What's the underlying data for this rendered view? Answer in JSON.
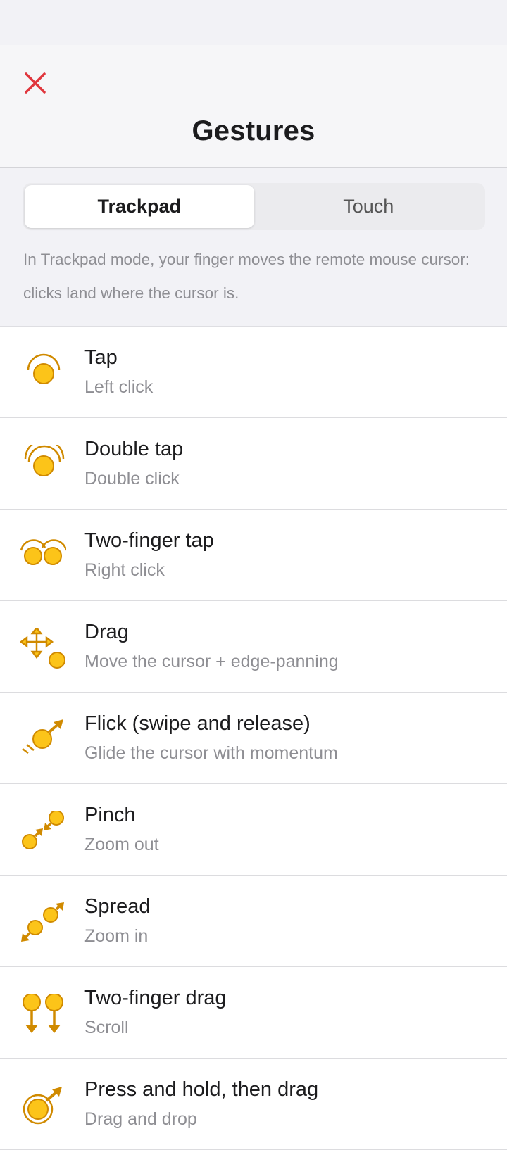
{
  "header": {
    "title": "Gestures"
  },
  "mode": {
    "tabs": [
      "Trackpad",
      "Touch"
    ],
    "selected": "Trackpad",
    "description": "In Trackpad mode, your finger moves the remote mouse cursor: clicks land where the cursor is."
  },
  "gestures": [
    {
      "label": "Tap",
      "sub": "Left click",
      "icon": "tap-icon"
    },
    {
      "label": "Double tap",
      "sub": "Double click",
      "icon": "double-tap-icon"
    },
    {
      "label": "Two-finger tap",
      "sub": "Right click",
      "icon": "two-finger-tap-icon"
    },
    {
      "label": "Drag",
      "sub": "Move the cursor + edge-panning",
      "icon": "drag-icon"
    },
    {
      "label": "Flick (swipe and release)",
      "sub": "Glide the cursor with momentum",
      "icon": "flick-icon"
    },
    {
      "label": "Pinch",
      "sub": "Zoom out",
      "icon": "pinch-icon"
    },
    {
      "label": "Spread",
      "sub": "Zoom in",
      "icon": "spread-icon"
    },
    {
      "label": "Two-finger drag",
      "sub": "Scroll",
      "icon": "two-finger-drag-icon"
    },
    {
      "label": "Press and hold, then drag",
      "sub": "Drag and drop",
      "icon": "press-hold-drag-icon"
    }
  ],
  "colors": {
    "close": "#e0363d",
    "icon_fill": "#fcc419",
    "icon_stroke": "#d08a00"
  }
}
